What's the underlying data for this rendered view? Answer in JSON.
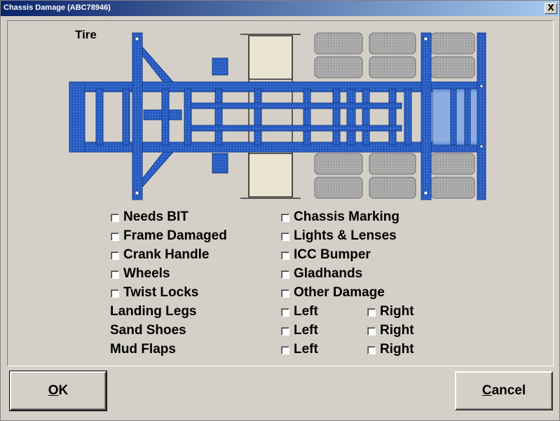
{
  "window": {
    "title": "Chassis Damage (ABC78946)",
    "close_glyph": "X"
  },
  "diagram": {
    "label": "Tire"
  },
  "left_column": [
    {
      "label": "Needs BIT",
      "checked": false
    },
    {
      "label": "Frame Damaged",
      "checked": false
    },
    {
      "label": "Crank Handle",
      "checked": false
    },
    {
      "label": "Wheels",
      "checked": false
    },
    {
      "label": "Twist Locks",
      "checked": false
    }
  ],
  "right_column": [
    {
      "label": "Chassis Marking",
      "checked": false
    },
    {
      "label": "Lights & Lenses",
      "checked": false
    },
    {
      "label": "ICC Bumper",
      "checked": false
    },
    {
      "label": "Gladhands",
      "checked": false
    },
    {
      "label": "Other Damage",
      "checked": false
    }
  ],
  "paired": [
    {
      "label": "Landing Legs",
      "left": "Left",
      "right": "Right"
    },
    {
      "label": "Sand Shoes",
      "left": "Left",
      "right": "Right"
    },
    {
      "label": "Mud Flaps",
      "left": "Left",
      "right": "Right"
    }
  ],
  "buttons": {
    "ok": {
      "mnemonic": "O",
      "rest": "K"
    },
    "cancel": {
      "mnemonic": "C",
      "rest": "ancel"
    }
  },
  "colors": {
    "frame_blue": "#2a5fc4",
    "tire_gray": "#a8a8a8",
    "title_blue": "#0a246a"
  }
}
